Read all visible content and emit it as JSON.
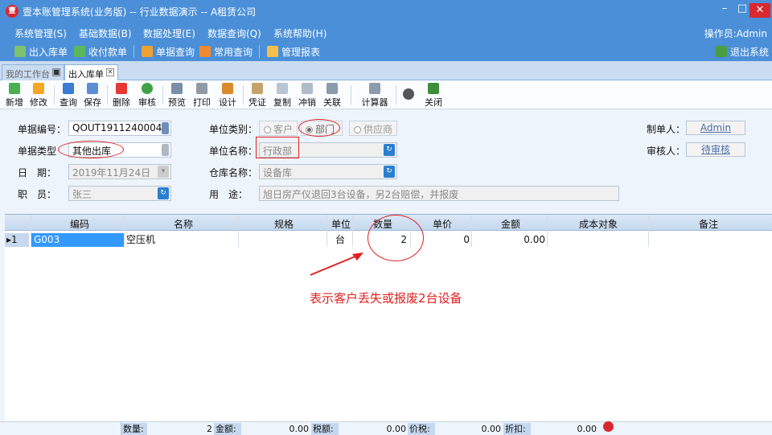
{
  "window": {
    "title": "壹本账管理系统(业务版) -- 行业数据演示 -- A租赁公司",
    "minimize": "–",
    "maximize": "□",
    "close": "✕"
  },
  "menu": [
    "系统管理(S)",
    "基础数据(B)",
    "数据处理(E)",
    "数据查询(Q)",
    "系统帮助(H)"
  ],
  "operator": "操作员:Admin",
  "quickbar": {
    "items": [
      "出入库单",
      "收付款单",
      "单据查询",
      "常用查询",
      "管理报表"
    ],
    "exit": "退出系统"
  },
  "tabs": [
    {
      "label": "我的工作台"
    },
    {
      "label": "出入库单"
    }
  ],
  "toolbar": [
    "新增",
    "修改",
    "查询",
    "保存",
    "删除",
    "审核",
    "预览",
    "打印",
    "设计",
    "凭证",
    "复制",
    "冲销",
    "关联",
    "计算器",
    "关闭"
  ],
  "form": {
    "doc_no_label": "单据编号：",
    "doc_no": "QOUT1911240004",
    "doc_type_label": "单据类型",
    "doc_type": "其他出库",
    "date_label": "日　期：",
    "date": "2019年11月24日",
    "staff_label": "职　员：",
    "staff": "张三",
    "unit_type_label": "单位类别：",
    "unit_types": [
      "客户",
      "部门",
      "供应商"
    ],
    "unit_name_label": "单位名称：",
    "unit_name": "行政部",
    "warehouse_label": "仓库名称：",
    "warehouse": "设备库",
    "purpose_label": "用　途：",
    "purpose": "旭日房产仪退回3台设备，另2台赔偿，并报废",
    "maker_label": "制单人：",
    "maker": "Admin",
    "auditor_label": "审核人：",
    "auditor": "待审核"
  },
  "grid": {
    "columns": [
      "编码",
      "名称",
      "规格",
      "单位",
      "数量",
      "单价",
      "金额",
      "成本对象",
      "备注"
    ],
    "rows": [
      {
        "idx": "1",
        "code": "G003",
        "name": "空压机",
        "spec": "",
        "unit": "台",
        "qty": "2",
        "price": "0",
        "amount": "0.00",
        "cost_obj": "",
        "remark": ""
      }
    ]
  },
  "annotation": "表示客户丢失或报废2台设备",
  "footer": {
    "qty_label": "数量:",
    "qty": "2",
    "amount_label": "金额:",
    "amount": "0.00",
    "tax_label": "税额:",
    "tax": "0.00",
    "total_label": "价税:",
    "total": "0.00",
    "discount_label": "折扣:",
    "discount": "0.00"
  },
  "colors": {
    "title_blue": "#4a8fd8",
    "annotation_red": "#e02020",
    "selected_cell": "#3399ff"
  }
}
